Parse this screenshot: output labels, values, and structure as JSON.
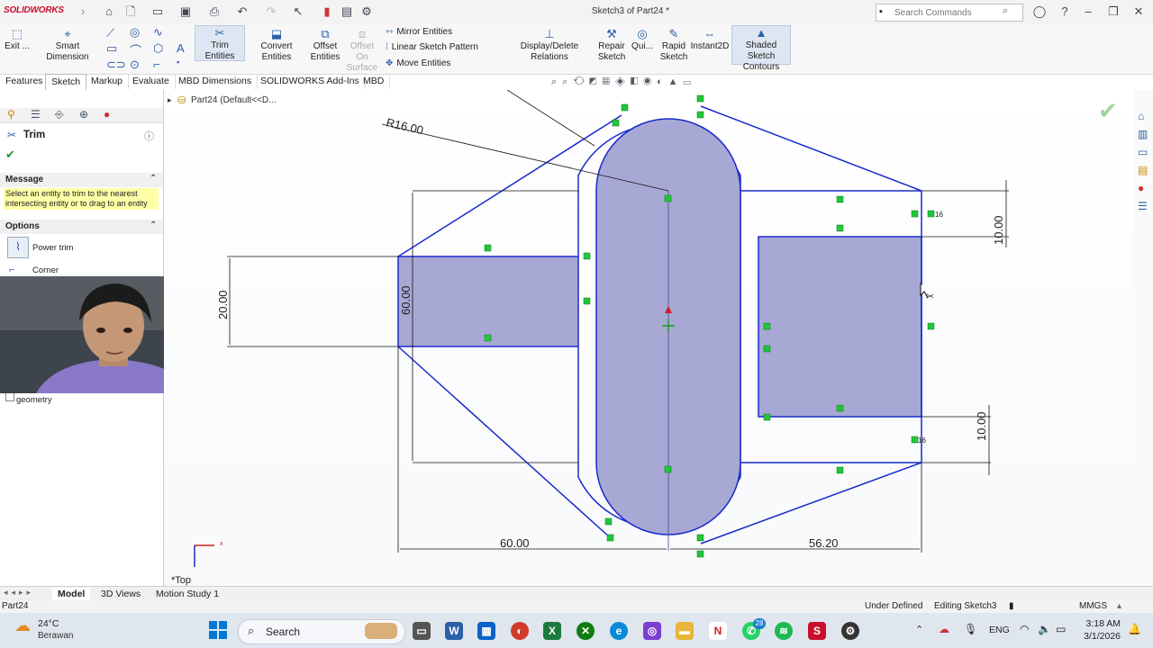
{
  "titlebar": {
    "app_name": "SOLIDWORKS",
    "document_title": "Sketch3 of Part24 *",
    "search_placeholder": "Search Commands"
  },
  "ribbon": {
    "exit_label": "Exit ...",
    "smart_dimension_label": "Smart Dimension",
    "trim_entities_label": "Trim Entities",
    "convert_entities_label": "Convert Entities",
    "offset_entities_label": "Offset Entities",
    "offset_on_surface_label": "Offset On Surface",
    "mirror_entities_label": "Mirror Entities",
    "linear_sketch_pattern_label": "Linear Sketch Pattern",
    "move_entities_label": "Move Entities",
    "display_delete_relations_label": "Display/Delete Relations",
    "repair_sketch_label": "Repair Sketch",
    "quick_snaps_label": "Qui...",
    "rapid_sketch_label": "Rapid Sketch",
    "instant2d_label": "Instant2D",
    "shaded_sketch_contours_label": "Shaded Sketch Contours"
  },
  "tabs": [
    "Features",
    "Sketch",
    "Markup",
    "Evaluate",
    "MBD Dimensions",
    "SOLIDWORKS Add-Ins",
    "MBD"
  ],
  "active_tab": "Sketch",
  "tree": {
    "part_label": "Part24 (Default<<D..."
  },
  "property_manager": {
    "title": "Trim",
    "message_header": "Message",
    "message_text": "Select an entity to trim to the nearest intersecting entity or to drag to an entity",
    "options_header": "Options",
    "option_power_trim": "Power trim",
    "option_corner": "Corner",
    "geometry_label": "geometry"
  },
  "sketch": {
    "radius_dim": "R16.00",
    "dim_height_left": "20.00",
    "dim_height_inner": "60.00",
    "dim_top_right": "10.00",
    "dim_bottom_right": "10.00",
    "dim_width_left": "60.00",
    "dim_width_right": "56.20",
    "relation_1": "16",
    "relation_2": "16",
    "view_label": "*Top"
  },
  "bottom_tabs": [
    "Model",
    "3D Views",
    "Motion Study 1"
  ],
  "active_bottom_tab": "Model",
  "status": {
    "left": "Part24",
    "under_defined": "Under Defined",
    "editing": "Editing Sketch3",
    "units": "MMGS"
  },
  "taskbar": {
    "temperature": "24°C",
    "weather": "Berawan",
    "search_label": "Search",
    "language": "ENG",
    "time": "3:18 AM",
    "date": "3/1/2026",
    "badge_count": "28"
  },
  "colors": {
    "sketch_line": "#1a2bcc",
    "shaded_fill": "#a7a8d4",
    "relation_green": "#22c63a",
    "accent": "#2b5fa8"
  }
}
